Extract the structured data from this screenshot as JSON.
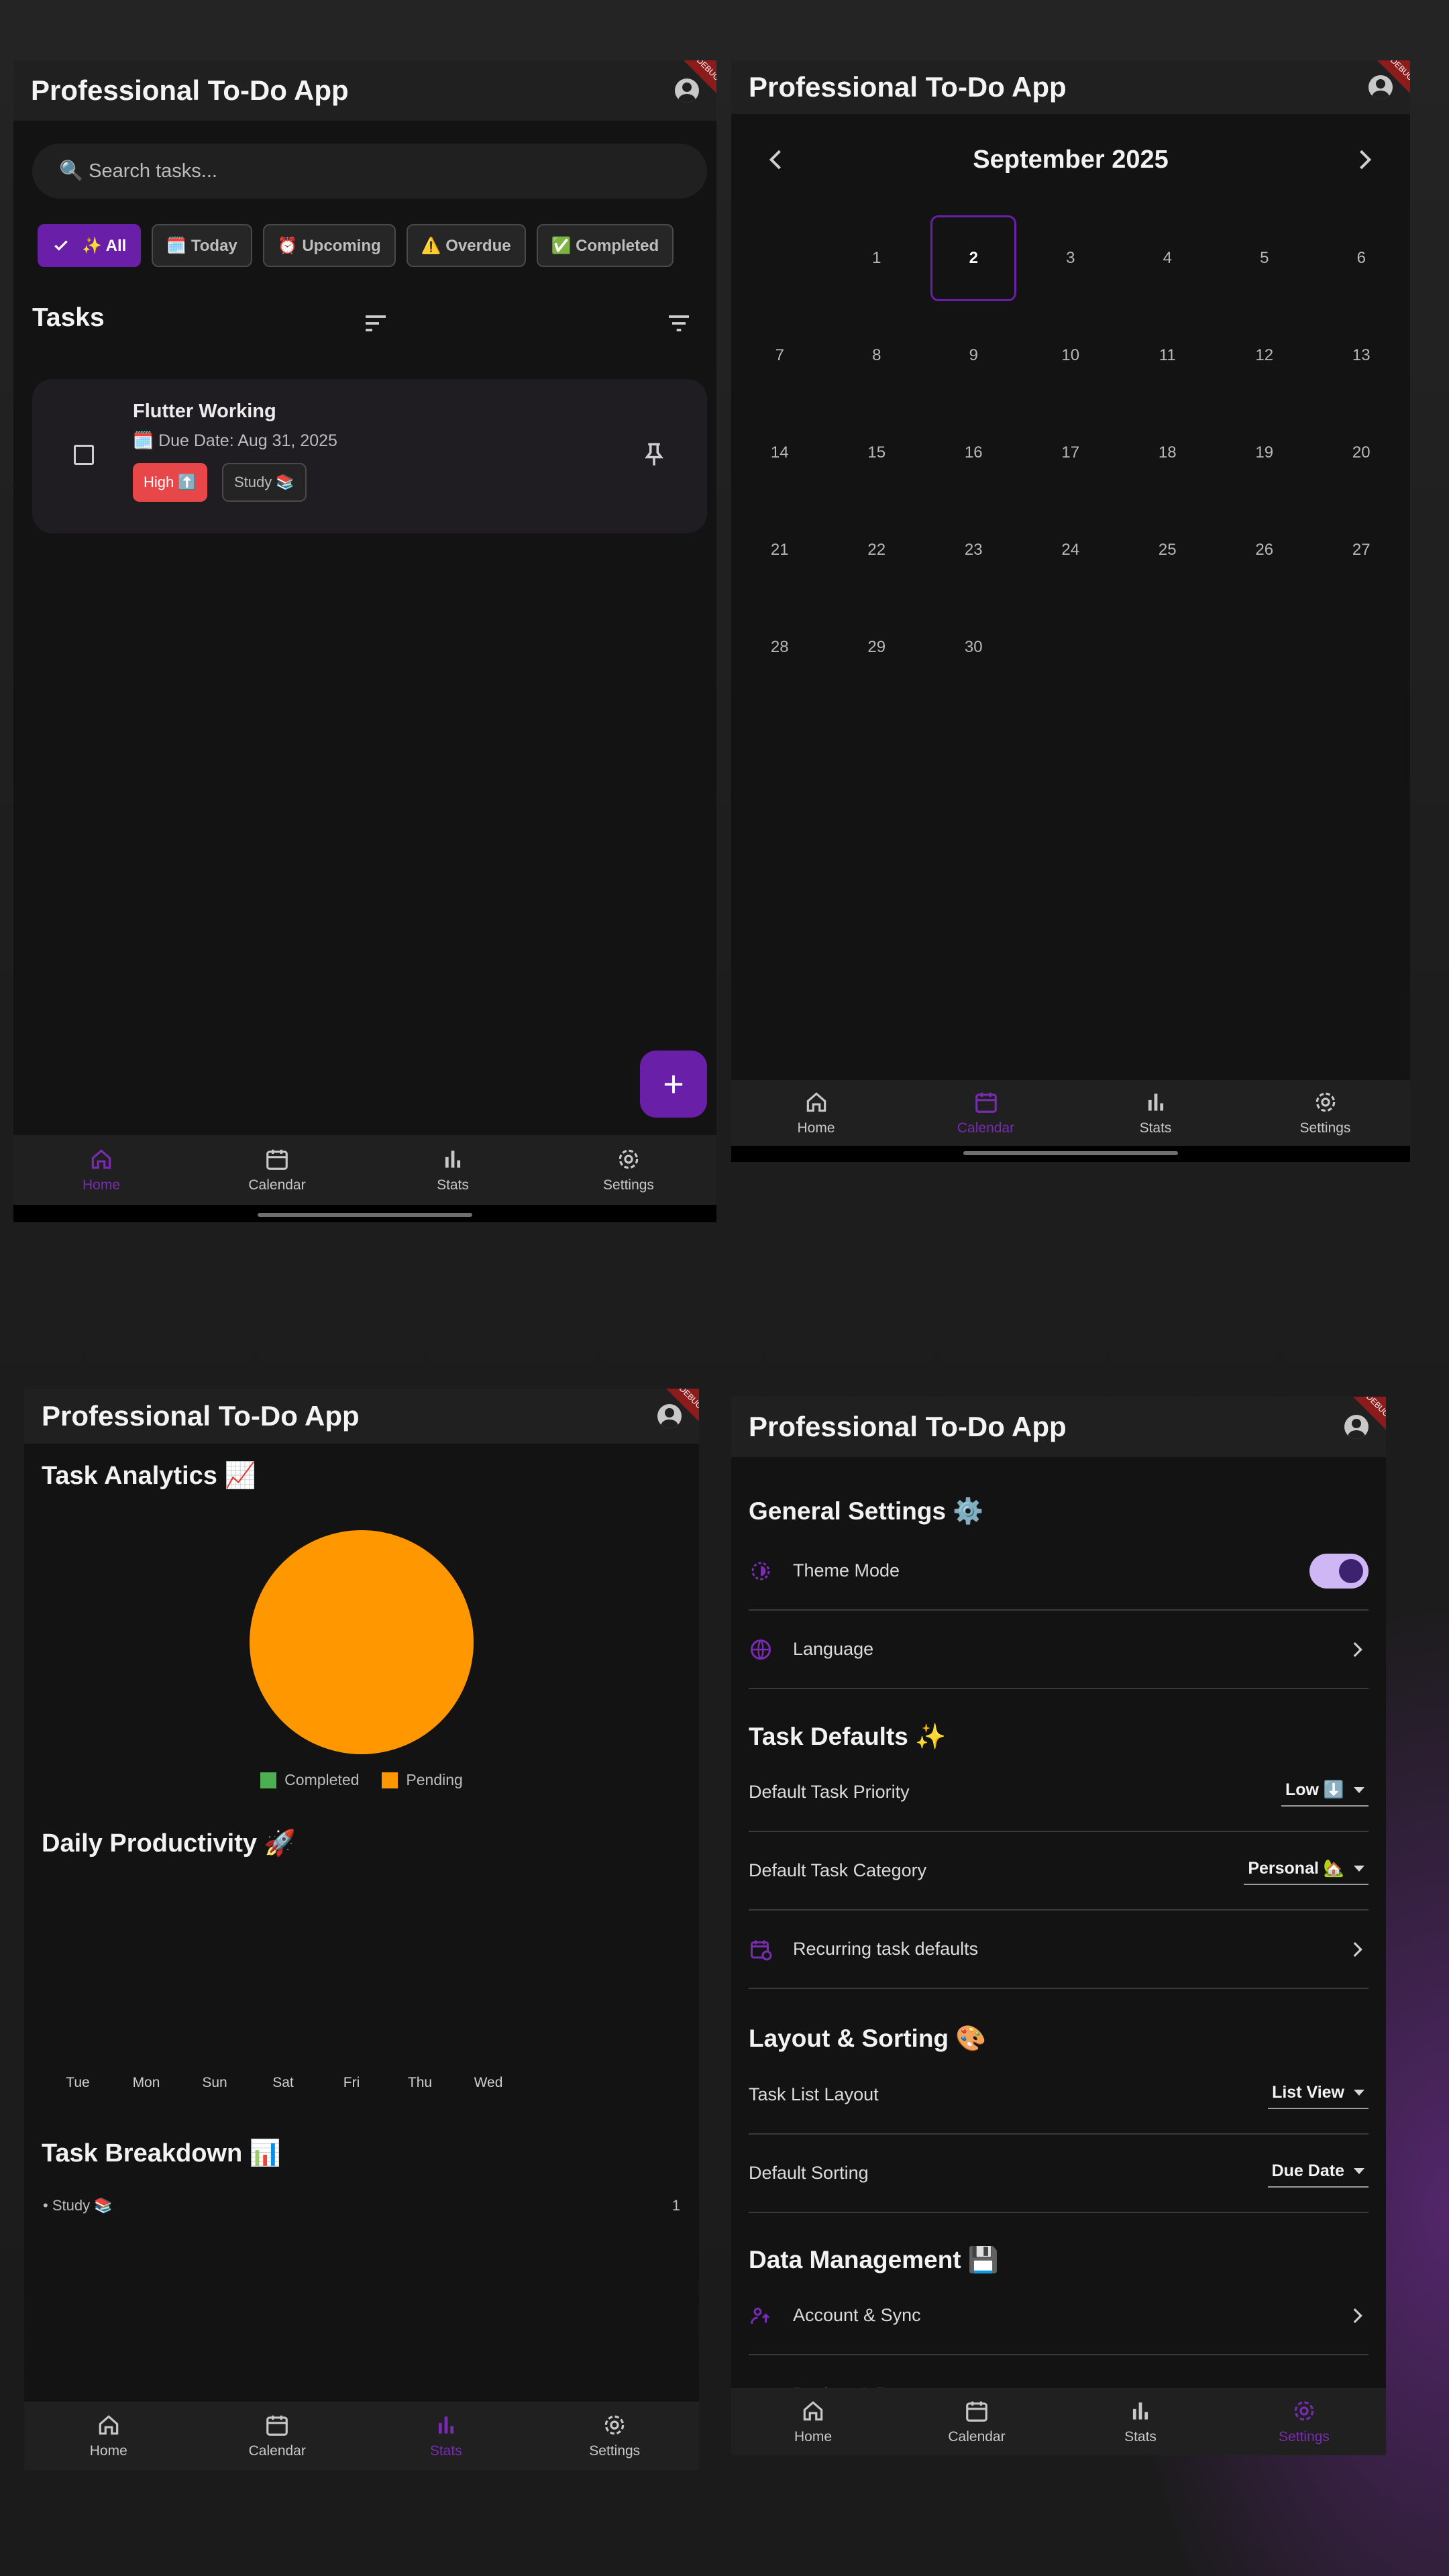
{
  "app_title": "Professional To-Do App",
  "badge_text": "DEBUG",
  "nav": {
    "home": "Home",
    "calendar": "Calendar",
    "stats": "Stats",
    "settings": "Settings"
  },
  "home": {
    "search_placeholder": "🔍 Search tasks...",
    "filters": [
      {
        "label": "✨ All",
        "selected": true
      },
      {
        "label": "🗓️ Today",
        "selected": false
      },
      {
        "label": "⏰ Upcoming",
        "selected": false
      },
      {
        "label": "⚠️ Overdue",
        "selected": false
      },
      {
        "label": "✅ Completed",
        "selected": false
      }
    ],
    "tasks_heading": "Tasks",
    "task": {
      "title": "Flutter Working",
      "due": "🗓️ Due Date: Aug 31, 2025",
      "priority": "High ⬆️",
      "category": "Study 📚"
    },
    "fab_label": "+"
  },
  "calendar": {
    "month_title": "September 2025",
    "selected_day": 2,
    "days": [
      "",
      "1",
      "2",
      "3",
      "4",
      "5",
      "6",
      "7",
      "8",
      "9",
      "10",
      "11",
      "12",
      "13",
      "14",
      "15",
      "16",
      "17",
      "18",
      "19",
      "20",
      "21",
      "22",
      "23",
      "24",
      "25",
      "26",
      "27",
      "28",
      "29",
      "30"
    ]
  },
  "stats": {
    "analytics_heading": "Task Analytics 📈",
    "productivity_heading": "Daily Productivity 🚀",
    "breakdown_heading": "Task Breakdown 📊",
    "breakdown_items": [
      {
        "label": "• Study 📚",
        "count": "1"
      }
    ],
    "chart_data": [
      {
        "type": "pie",
        "labels": [
          "Completed",
          "Pending"
        ],
        "values": [
          0,
          1
        ],
        "colors": [
          "#4caf50",
          "#ff9800"
        ],
        "legend": "bottom"
      },
      {
        "type": "bar",
        "categories": [
          "Tue",
          "Mon",
          "Sun",
          "Sat",
          "Fri",
          "Thu",
          "Wed"
        ],
        "values": [
          0,
          0,
          0,
          0,
          0,
          0,
          0
        ]
      }
    ]
  },
  "settings": {
    "general_heading": "General Settings ⚙️",
    "theme_mode": "Theme Mode",
    "theme_toggle_on": true,
    "language": "Language",
    "task_defaults_heading": "Task Defaults ✨",
    "default_priority_label": "Default Task Priority",
    "default_priority_value": "Low ⬇️",
    "default_category_label": "Default Task Category",
    "default_category_value": "Personal 🏡",
    "recurring": "Recurring task defaults",
    "layout_heading": "Layout & Sorting 🎨",
    "layout_label": "Task List Layout",
    "layout_value": "List View",
    "sorting_label": "Default Sorting",
    "sorting_value": "Due Date",
    "data_heading": "Data Management 💾",
    "account_sync": "Account & Sync",
    "partial_row": "Backup & Restore"
  },
  "colors": {
    "accent": "#6a1fa8",
    "pie_pending": "#ff9800",
    "pie_completed": "#4caf50",
    "high_priority": "#e8474a"
  }
}
